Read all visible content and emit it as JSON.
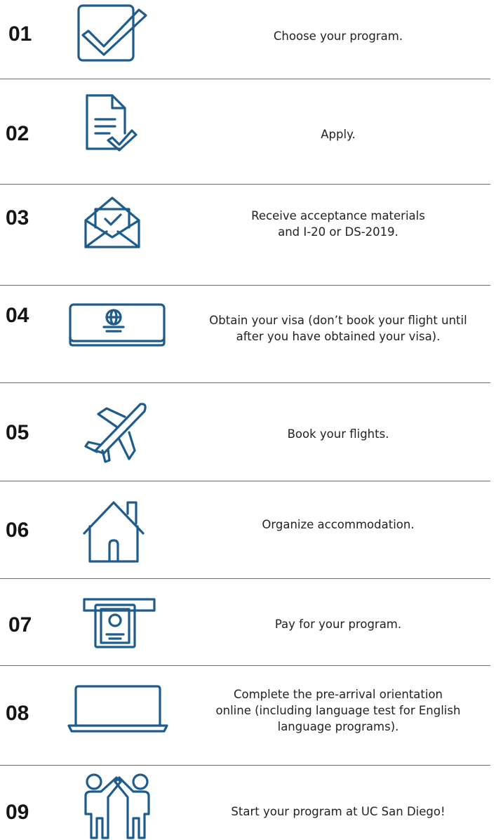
{
  "colors": {
    "icon_stroke": "#1e5c8c",
    "number_text": "#141414",
    "body_text": "#222222",
    "divider": "#6e6e6e"
  },
  "steps": [
    {
      "number": "01",
      "icon": "checkbox-check-icon",
      "text": "Choose your program."
    },
    {
      "number": "02",
      "icon": "document-check-icon",
      "text": "Apply."
    },
    {
      "number": "03",
      "icon": "envelope-letter-icon",
      "text": "Receive acceptance materials\nand I-20 or DS-2019."
    },
    {
      "number": "04",
      "icon": "passport-globe-icon",
      "text": "Obtain your visa (don’t book your flight until\nafter you have obtained your visa)."
    },
    {
      "number": "05",
      "icon": "airplane-icon",
      "text": "Book your flights."
    },
    {
      "number": "06",
      "icon": "house-icon",
      "text": "Organize accommodation."
    },
    {
      "number": "07",
      "icon": "atm-cash-icon",
      "text": "Pay for your program."
    },
    {
      "number": "08",
      "icon": "laptop-icon",
      "text": "Complete the pre-arrival orientation\nonline (including language test for English\nlanguage programs)."
    },
    {
      "number": "09",
      "icon": "people-high-five-icon",
      "text": "Start your program at UC San Diego!"
    }
  ]
}
